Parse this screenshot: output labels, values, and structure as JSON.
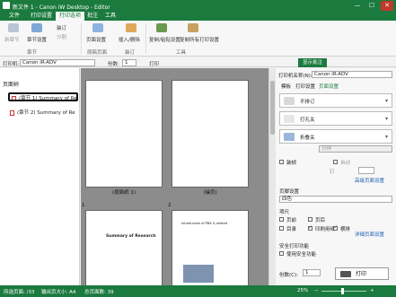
{
  "window": {
    "title": "新文件 1 - Canon iW Desktop - Editor",
    "min": "—",
    "max": "☐",
    "close": "✕"
  },
  "tabs": [
    "文件",
    "打印设置",
    "打印选项",
    "批注",
    "工具"
  ],
  "ribbon": {
    "new_chapter": "新章节",
    "chapter_settings": "章节设置",
    "staple": "装订",
    "split": "分割",
    "group_chapter": "章节",
    "page_settings": "页面设置",
    "insert_remove": "插入/删除",
    "group_pages": "原稿页面",
    "group_book": "装订",
    "copy_paste_settings": "复制/粘贴设置",
    "copy_all_pages": "复制所有打印设置",
    "group_tools": "工具"
  },
  "toolbar2": {
    "printer_label": "打印机:",
    "printer_value": "Canon iR-ADV",
    "copies_label": "份数:",
    "copies_value": "1",
    "print_label": "打印",
    "show_comments": "显示批注"
  },
  "left_pane": {
    "header": "页面树",
    "items": [
      {
        "label": "(章节 1) Summary of Re"
      },
      {
        "label": "(章节 2) Summary of Re"
      }
    ]
  },
  "center": {
    "pages": [
      {
        "label": "(按面纸 1)"
      },
      {
        "label": "(操页)"
      },
      {
        "num": "1",
        "heading": "Summary of Research"
      },
      {
        "num": "2",
        "heading": "Introduction of PBX & related"
      }
    ]
  },
  "right_pane": {
    "printer_label": "打印机名称(N):",
    "printer_value": "Canon iR-ADV",
    "tabs": [
      "模板",
      "打印设置",
      "页面设置"
    ],
    "opts": [
      "不排订",
      "打孔关",
      "折叠关"
    ],
    "disabled_select": "分钟",
    "binding_label": "装订",
    "binding_value_label": "自动",
    "more_link": "高级页面设置",
    "chk_duplex": "装帧",
    "chk_auto": "自动",
    "size_label": "钉",
    "finish_label": "页脚设置",
    "finish_value": "四色",
    "other_label": "项尺",
    "c1": "页前",
    "c2": "页后",
    "c3": "目录",
    "c4": "印刷用纸",
    "c5": "横排",
    "detail_link": "详细页面设置",
    "security_label": "安全打印功能",
    "security_opt": "使用安全功能",
    "copies_label": "份数(C):",
    "copies_value": "1",
    "print_btn": "打印"
  },
  "status": {
    "total_pages": "所选页面: /33",
    "output_size": "输出页大小: A4",
    "total_sheets": "总页面数: 39",
    "zoom": "25%",
    "zoom_minus": "−",
    "zoom_plus": "+"
  }
}
